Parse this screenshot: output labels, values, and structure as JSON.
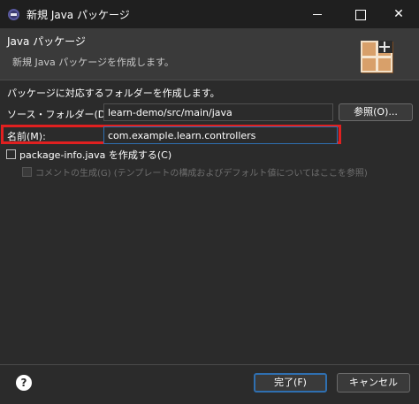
{
  "window": {
    "title": "新規 Java パッケージ",
    "minimize_glyph": "",
    "maximize_glyph": "",
    "close_glyph": "✕"
  },
  "banner": {
    "title": "Java パッケージ",
    "description": "新規 Java パッケージを作成します。"
  },
  "form": {
    "intro": "パッケージに対応するフォルダーを作成します。",
    "source_folder_label": "ソース・フォルダー(D):",
    "source_folder_value": "learn-demo/src/main/java",
    "browse_label": "参照(O)...",
    "name_label": "名前(M):",
    "name_value": "com.example.learn.controllers",
    "create_package_info_label": "package-info.java を作成する(C)",
    "create_package_info_checked": false,
    "generate_comments_label": "コメントの生成(G) (テンプレートの構成およびデフォルト値についてはここを参照)",
    "generate_comments_enabled": false
  },
  "footer": {
    "help_glyph": "?",
    "finish_label": "完了(F)",
    "cancel_label": "キャンセル"
  },
  "colors": {
    "highlight": "#e02020",
    "focus": "#2f6fb0"
  }
}
